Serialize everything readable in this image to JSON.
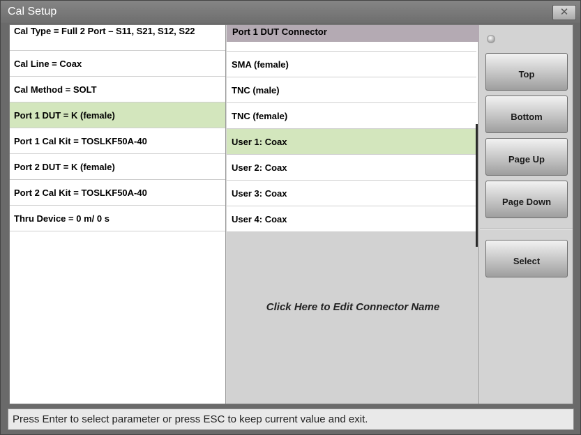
{
  "window": {
    "title": "Cal Setup",
    "close_symbol": "✕"
  },
  "parameters": [
    {
      "label": "Cal Type = Full 2 Port – S11, S21, S12, S22",
      "selected": false
    },
    {
      "label": "Cal Line = Coax",
      "selected": false
    },
    {
      "label": "Cal Method = SOLT",
      "selected": false
    },
    {
      "label": "Port 1 DUT = K (female)",
      "selected": true
    },
    {
      "label": "Port 1 Cal Kit = TOSLKF50A-40",
      "selected": false
    },
    {
      "label": "Port 2 DUT = K (female)",
      "selected": false
    },
    {
      "label": "Port 2 Cal Kit = TOSLKF50A-40",
      "selected": false
    },
    {
      "label": "Thru Device = 0 m/ 0 s",
      "selected": false
    }
  ],
  "connector_list": {
    "header": "Port 1 DUT Connector",
    "items": [
      {
        "label": "SMA (female)",
        "selected": false
      },
      {
        "label": "TNC (male)",
        "selected": false
      },
      {
        "label": "TNC (female)",
        "selected": false
      },
      {
        "label": "User 1: Coax",
        "selected": true
      },
      {
        "label": "User 2: Coax",
        "selected": false
      },
      {
        "label": "User 3: Coax",
        "selected": false
      },
      {
        "label": "User 4: Coax",
        "selected": false
      }
    ],
    "edit_prompt": "Click Here to Edit Connector Name"
  },
  "buttons": {
    "top": "Top",
    "bottom": "Bottom",
    "page_up": "Page Up",
    "page_down": "Page Down",
    "select": "Select"
  },
  "status": "Press Enter to select parameter or press ESC to keep current value and exit.",
  "colors": {
    "selected_row": "#d3e6bd",
    "header_bg": "#b4aab3"
  }
}
